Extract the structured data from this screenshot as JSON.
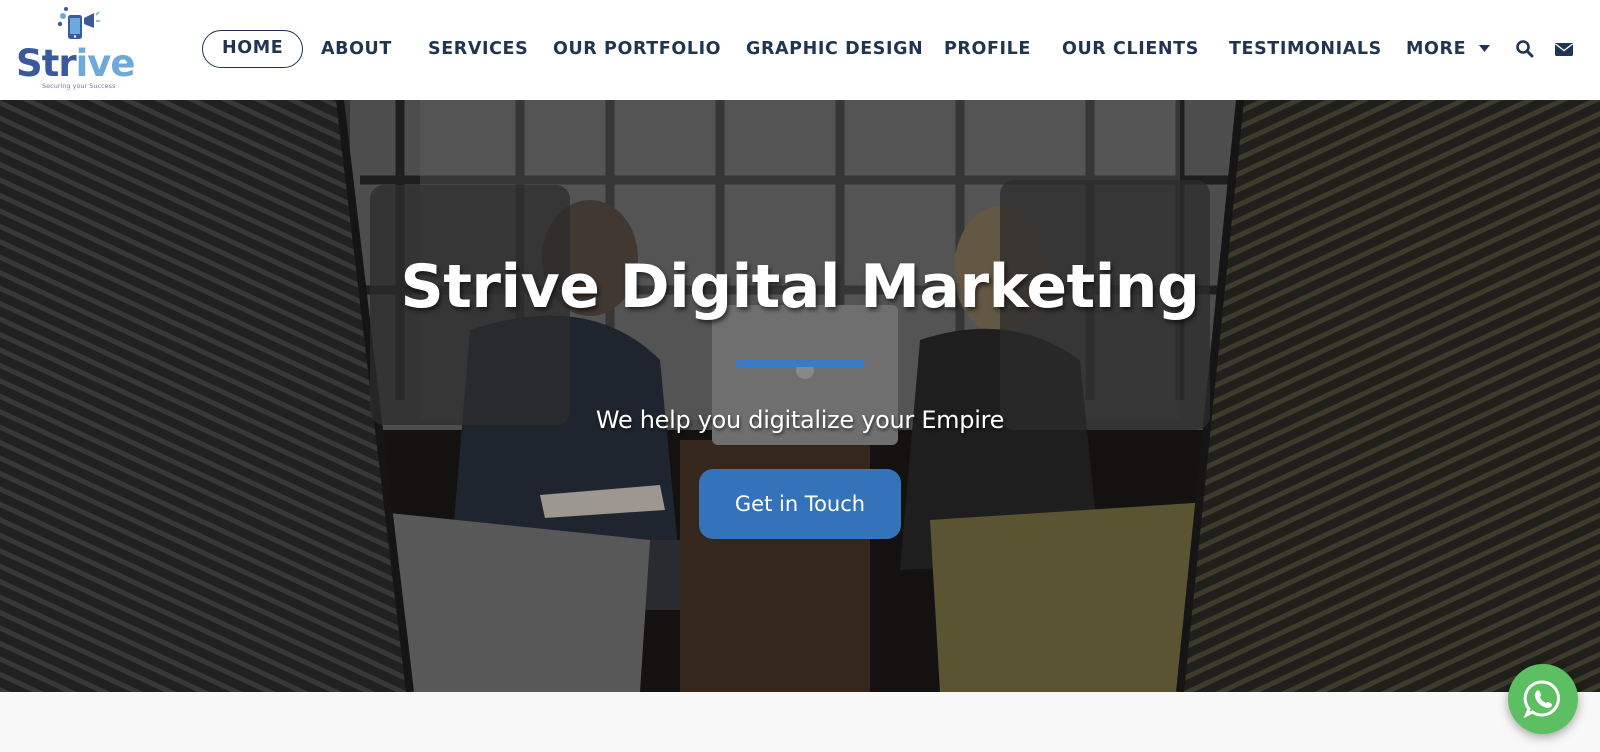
{
  "brand": {
    "logo_word_dark": "Str",
    "logo_word_light": "ive",
    "tagline": "Securing your Success",
    "colors": {
      "dark_blue": "#3b5a9d",
      "light_blue": "#6fa8dc"
    }
  },
  "nav": {
    "items": [
      {
        "label": "HOME",
        "active": true
      },
      {
        "label": "ABOUT"
      },
      {
        "label": "SERVICES"
      },
      {
        "label": "OUR PORTFOLIO"
      },
      {
        "label": "GRAPHIC DESIGN"
      },
      {
        "label": "PROFILE"
      },
      {
        "label": "OUR CLIENTS"
      },
      {
        "label": "TESTIMONIALS"
      },
      {
        "label": "MORE"
      }
    ],
    "icons": [
      "search-icon",
      "envelope-icon",
      "caret-down-icon"
    ],
    "text_color": "#1f3552"
  },
  "hero": {
    "title": "Strive Digital Marketing",
    "subtitle": "We help you digitalize your Empire",
    "cta_label": "Get in Touch",
    "accent_color": "#3a7bc8",
    "button_color": "#3473b9"
  },
  "floating": {
    "whatsapp_icon": "whatsapp-icon",
    "color": "#5cbf61"
  }
}
